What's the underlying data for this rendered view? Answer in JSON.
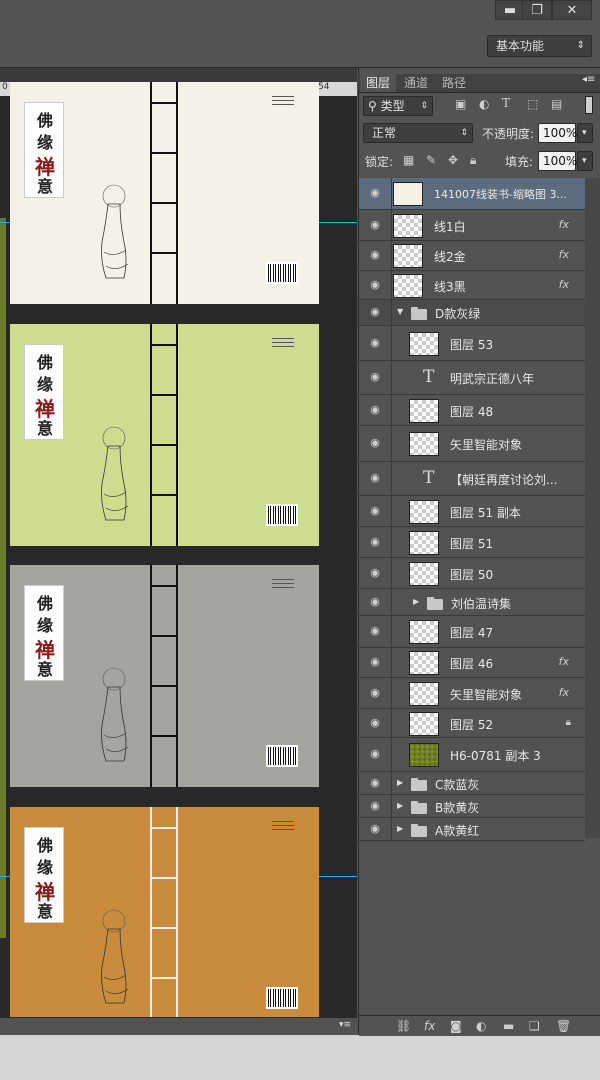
{
  "window": {
    "minimize": "▬",
    "restore": "❐",
    "close": "✕"
  },
  "workspace": {
    "label": "基本功能"
  },
  "ruler": {
    "tick_left": "0",
    "tick_right": "54"
  },
  "panel": {
    "tabs": [
      "图层",
      "通道",
      "路径"
    ],
    "filter_kind": "类型",
    "blend_mode": "正常",
    "opacity_label": "不透明度:",
    "opacity_value": "100%",
    "lock_label": "锁定:",
    "fill_label": "填充:",
    "fill_value": "100%"
  },
  "layers": [
    {
      "name": "141007线装书-缩略图 3...",
      "kind": "doc",
      "selected": true
    },
    {
      "name": "线1白",
      "kind": "pixel",
      "fx": true
    },
    {
      "name": "线2金",
      "kind": "pixel",
      "fx": true
    },
    {
      "name": "线3黑",
      "kind": "pixel",
      "fx": true
    },
    {
      "name": "D款灰绿",
      "kind": "group",
      "open": true
    },
    {
      "name": "图层 53",
      "kind": "pixel",
      "indent": true
    },
    {
      "name": "明武宗正德八年",
      "kind": "text",
      "indent": true
    },
    {
      "name": "图层 48",
      "kind": "pixel",
      "indent": true
    },
    {
      "name": "矢里智能对象",
      "kind": "smart",
      "indent": true
    },
    {
      "name": "【朝廷再度讨论刘...",
      "kind": "text",
      "indent": true
    },
    {
      "name": "图层 51 副本",
      "kind": "pixel",
      "indent": true
    },
    {
      "name": "图层 51",
      "kind": "pixel",
      "indent": true
    },
    {
      "name": "图层 50",
      "kind": "pixel",
      "indent": true
    },
    {
      "name": "刘伯温诗集",
      "kind": "group",
      "open": false,
      "indent": true
    },
    {
      "name": "图层 47",
      "kind": "pixel",
      "indent": true
    },
    {
      "name": "图层 46",
      "kind": "pixel",
      "indent": true,
      "fx": true
    },
    {
      "name": "矢里智能对象",
      "kind": "smart",
      "indent": true,
      "fx": true
    },
    {
      "name": "图层 52",
      "kind": "pixel",
      "indent": true,
      "locked": true
    },
    {
      "name": "H6-0781 副本 3",
      "kind": "texture",
      "indent": true
    },
    {
      "name": "C款蓝灰",
      "kind": "group",
      "open": false
    },
    {
      "name": "B款黄灰",
      "kind": "group",
      "open": false
    },
    {
      "name": "A款黄红",
      "kind": "group",
      "open": false
    }
  ],
  "covers": [
    {
      "color": "#f4f1e8",
      "spine": "dark"
    },
    {
      "color": "#cddc8e",
      "spine": "dark"
    },
    {
      "color": "#a5a59f",
      "spine": "dark"
    },
    {
      "color": "#c98c3c",
      "spine": "light"
    }
  ],
  "cover_title": [
    "佛",
    "缘",
    "禅",
    "意"
  ]
}
